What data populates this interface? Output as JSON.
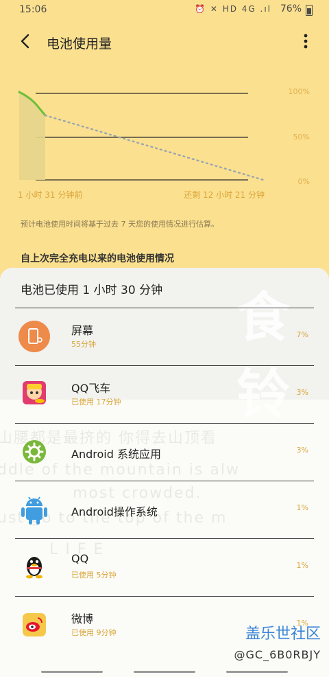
{
  "status_bar": {
    "time": "15:06",
    "icons": "⏰ ✕ HD 4G .ıl",
    "battery": "76%"
  },
  "app_bar": {
    "title": "电池使用量"
  },
  "chart": {
    "y_labels": [
      "100%",
      "50%",
      "0%"
    ],
    "x_start_label": "1 小时 31 分钟前",
    "x_end_label": "还剩 12 小时 21 分钟",
    "series_color": "#6cbf3a",
    "projection_color": "#9aa6b0"
  },
  "estimate_note": "预计电池使用时间将基于过去 7 天您的使用情况进行估算。",
  "section_header": "自上次完全充电以来的电池使用情况",
  "sheet": {
    "total_used": "电池已使用 1 小时 30 分钟"
  },
  "apps": [
    {
      "name": "屏幕",
      "detail": "55分钟",
      "percent": "7%",
      "icon": "screen-icon"
    },
    {
      "name": "QQ飞车",
      "detail": "已使用 17分钟",
      "percent": "3%",
      "icon": "qq-speed-icon"
    },
    {
      "name": "Android 系统应用",
      "detail": "",
      "percent": "3%",
      "icon": "android-settings-icon"
    },
    {
      "name": "Android操作系统",
      "detail": "",
      "percent": "1%",
      "icon": "android-robot-icon"
    },
    {
      "name": "QQ",
      "detail": "已使用 5分钟",
      "percent": "1%",
      "icon": "qq-penguin-icon"
    },
    {
      "name": "微博",
      "detail": "已使用 9分钟",
      "percent": "1%",
      "icon": "weibo-icon"
    }
  ],
  "watermark": {
    "big": "食铃",
    "line1": "山腰都是最挤的   你得去山顶看",
    "line2": "ddle of the mountain is alw",
    "line3": "most crowded.",
    "line4": "ust go to the top of the m",
    "line5": "L    I    F    E"
  },
  "overlay": {
    "brand": "盖乐世社区",
    "handle": "@GC_6B0RBJY"
  }
}
